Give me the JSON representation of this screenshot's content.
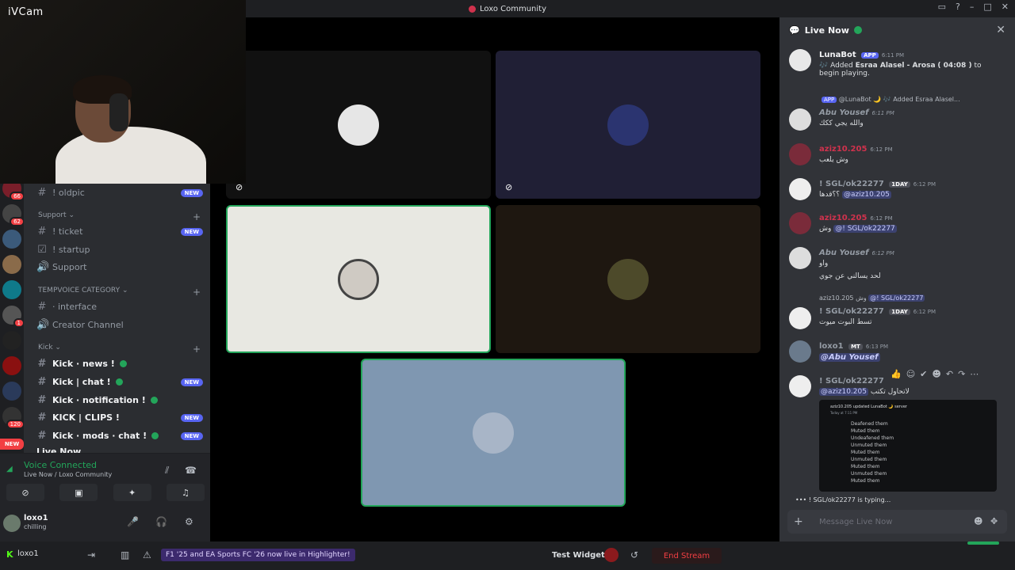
{
  "window": {
    "title": "Loxo Community"
  },
  "camera": {
    "brand": "iVCam"
  },
  "server_badges": [
    "66",
    "62",
    "1",
    "120"
  ],
  "server_new": "NEW",
  "channels": {
    "oldpic": "! oldpic",
    "oldpic_tag": "NEW",
    "support_cat": "Support ⌄",
    "ticket": "! ticket",
    "ticket_tag": "NEW",
    "startup": "! startup",
    "support": "Support",
    "tempvoice_cat": "TEMPVOICE CATEGORY ⌄",
    "interface": "· interface",
    "creator": "Creator Channel",
    "kick_cat": "Kick ⌄",
    "kick_news": "Kick · news !",
    "kick_chat": "Kick | chat !",
    "kick_chat_tag": "NEW",
    "kick_notif": "Kick · notification !",
    "kick_clips": "KICK | CLIPS !",
    "kick_clips_tag": "NEW",
    "kick_mods": "Kick · mods · chat !",
    "kick_mods_tag": "NEW",
    "live_now": "Live Now"
  },
  "voice": {
    "status": "Voice Connected",
    "location": "Live Now",
    "community": "/ Loxo Community"
  },
  "user": {
    "name": "loxo1",
    "status": "chilling"
  },
  "chat": {
    "header": "Live Now",
    "m1_author": "LunaBot",
    "m1_tag": "APP",
    "m1_time": "6:11 PM",
    "m1_text_pre": "🎶 Added",
    "m1_song": "Esraa Alasel - Arosa",
    "m1_dur": "( 04:08 )",
    "m1_text_post": "to begin playing.",
    "m2_reply": "@LunaBot 🌙 🎶 Added Esraa Alasel...",
    "m2_reply_tag": "APP",
    "m2_author": "Abu Yousef",
    "m2_time": "6:11 PM",
    "m2_text": "والله يجي ككك",
    "m3_author": "aziz10.205",
    "m3_time": "6:12 PM",
    "m3_text": "وش يلعب",
    "m4_author": "! SGL/ok22277",
    "m4_tag": "1DAY",
    "m4_time": "6:12 PM",
    "m4_text_pre": "؟؟قدها",
    "m4_mention": "@aziz10.205",
    "m5_author": "aziz10.205",
    "m5_time": "6:12 PM",
    "m5_text_pre": "وش",
    "m5_mention": "@! SGL/ok22277",
    "m6_author": "Abu Yousef",
    "m6_time": "6:12 PM",
    "m6_line1": "واو",
    "m6_line2": "لحد يسالني عن جوي",
    "m7_reply_pre": "aziz10.205 وش",
    "m7_reply_mention": "@! SGL/ok22277",
    "m7_author": "! SGL/ok22277",
    "m7_tag": "1DAY",
    "m7_time": "6:12 PM",
    "m7_text": "تسط البوت ميوت",
    "m8_author": "loxo1",
    "m8_tag": "MT",
    "m8_time": "6:13 PM",
    "m8_mention": "@Abu Yousef",
    "m9_author": "! SGL/ok22277",
    "m9_mention": "@aziz10.205",
    "m9_text": "لاتحاول تكتب",
    "embed_header": "aziz10.205 updated LunaBot 🌙 server",
    "embed_sub": "Today at 7:11 PM",
    "embed_rows": [
      "Deafened them",
      "Muted them",
      "Undeafened them",
      "Unmuted them",
      "Muted them",
      "Unmuted them",
      "Muted them",
      "Unmuted them",
      "Muted them"
    ],
    "typing": "! SGL/ok22277 is typing...",
    "input_placeholder": "Message Live Now"
  },
  "bottom": {
    "user": "loxo1",
    "banner": "F1 '25 and EA Sports FC '26 now live in Highlighter!",
    "test_widgets": "Test Widgets",
    "end_stream": "End Stream"
  },
  "colors": {
    "accent": "#5865f2",
    "online": "#23a55a",
    "danger": "#f23f43",
    "kick": "#53fc18"
  }
}
